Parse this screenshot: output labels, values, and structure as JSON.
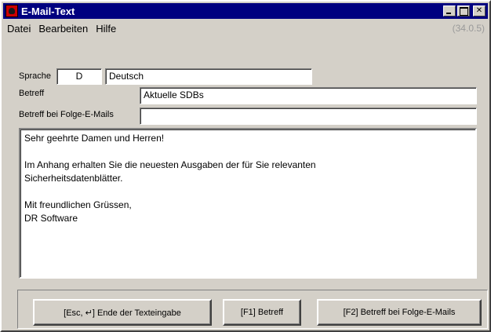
{
  "window": {
    "title": "E-Mail-Text",
    "buttons": [
      "_",
      "□",
      "X"
    ]
  },
  "menu": {
    "items": [
      "Datei",
      "Bearbeiten",
      "Hilfe"
    ],
    "version": "(34.0.5)"
  },
  "form": {
    "sprache_label": "Sprache",
    "sprache_code": "D",
    "sprache_name": "Deutsch",
    "betreff_label": "Betreff",
    "betreff_value": "Aktuelle SDBs",
    "folge_label": "Betreff bei Folge-E-Mails",
    "folge_value": ""
  },
  "body": {
    "lines": [
      "Sehr geehrte Damen und Herren!",
      "",
      "Im Anhang erhalten Sie die neuesten Ausgaben der für Sie relevanten",
      "Sicherheitsdatenblätter.",
      "",
      "Mit freundlichen Grüssen,",
      "DR Software"
    ]
  },
  "footer": {
    "btn_end": "[Esc, ↵] Ende der Texteingabe",
    "btn_betreff": "[F1] Betreff",
    "btn_folge": "[F2] Betreff bei Folge-E-Mails"
  },
  "colors": {
    "titlebar": "#000080",
    "face": "#d4d0c8",
    "version_text": "#9a9a9a"
  }
}
